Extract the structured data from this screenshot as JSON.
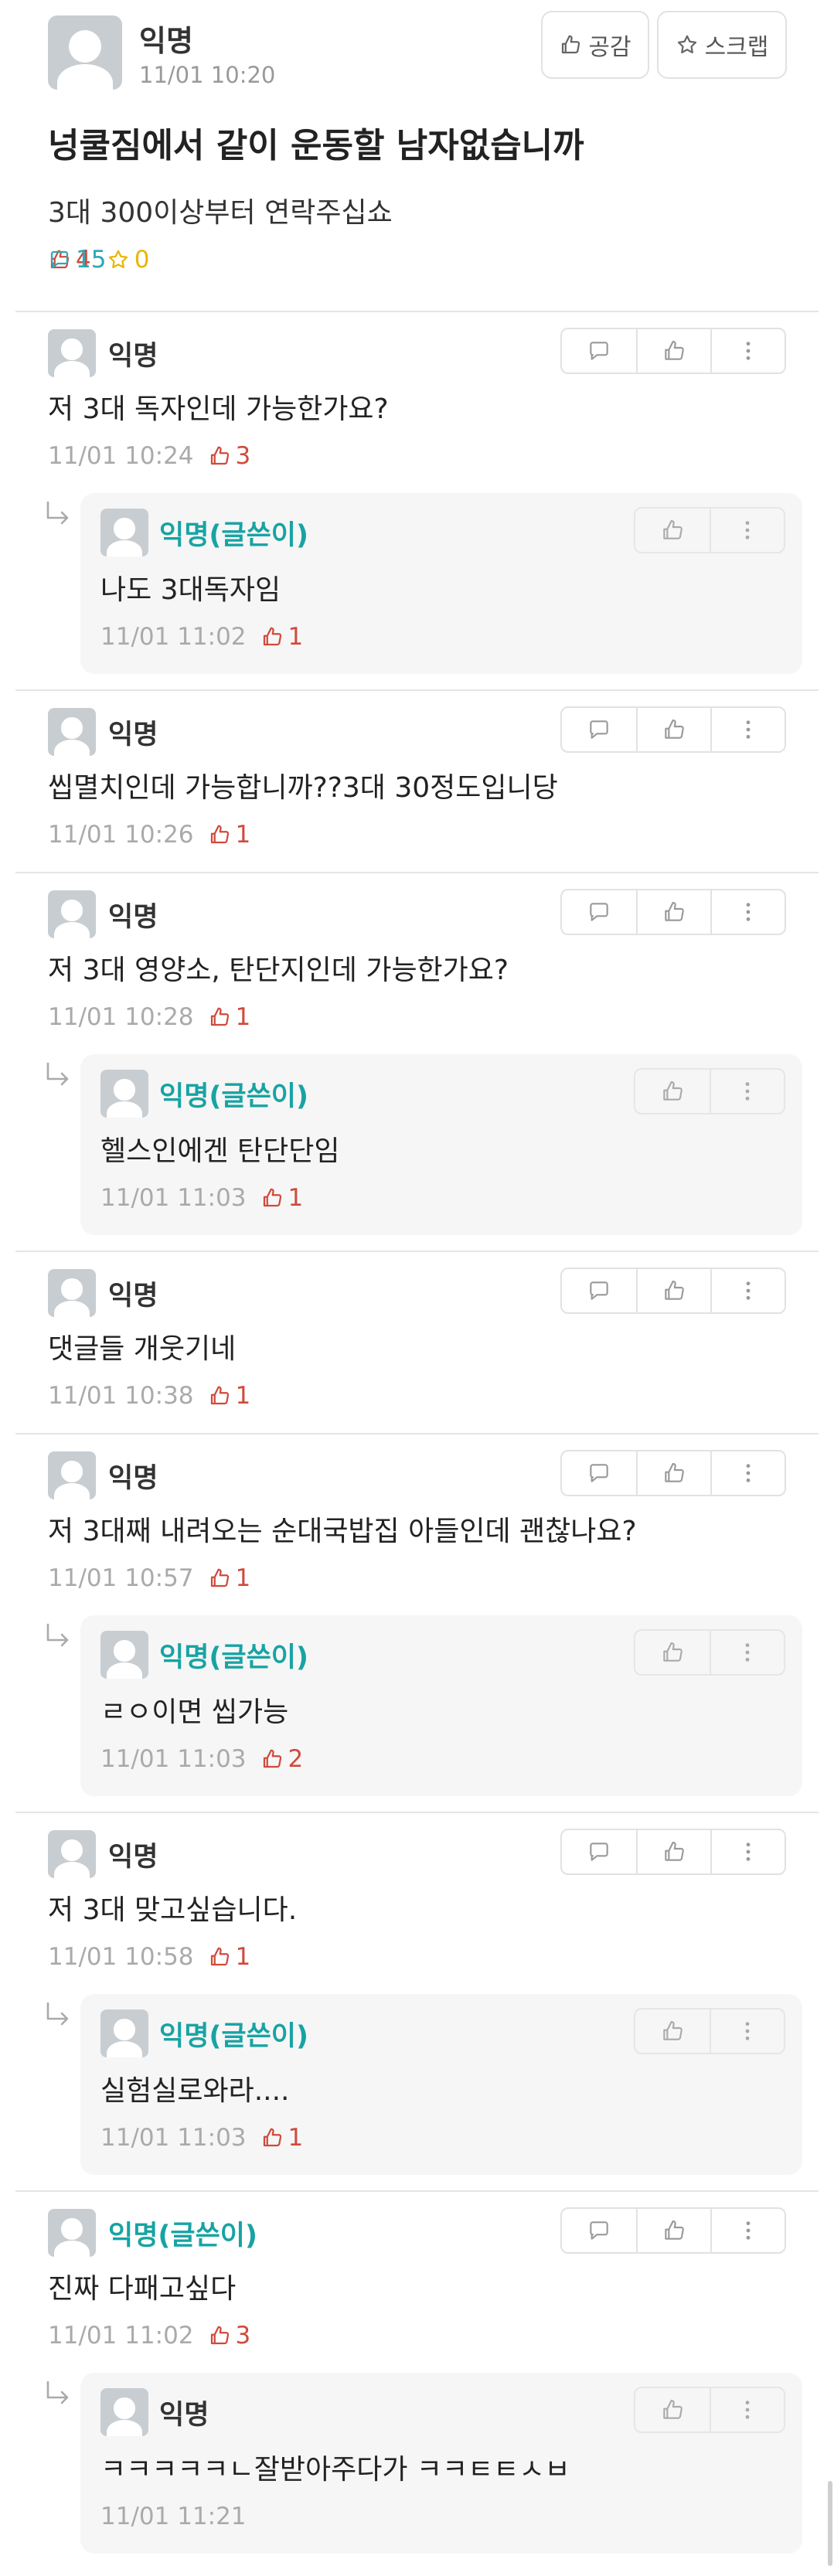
{
  "post": {
    "author": "익명",
    "time": "11/01 10:20",
    "title": "넝쿨짐에서 같이 운동할 남자없습니까",
    "body": "3대 300이상부터 연락주십쇼",
    "like_count": "4",
    "comment_count": "15",
    "scrap_count": "0",
    "like_button_label": "공감",
    "scrap_button_label": "스크랩"
  },
  "comments": [
    {
      "author": "익명",
      "text": "저 3대 독자인데 가능한가요?",
      "time": "11/01 10:24",
      "votes": "3"
    },
    {
      "author": "익명(글쓴이)",
      "text": "나도 3대독자임",
      "time": "11/01 11:02",
      "votes": "1"
    },
    {
      "author": "익명",
      "text": "씹멸치인데 가능합니까??3대 30정도입니당",
      "time": "11/01 10:26",
      "votes": "1"
    },
    {
      "author": "익명",
      "text": "저 3대 영양소, 탄단지인데 가능한가요?",
      "time": "11/01 10:28",
      "votes": "1"
    },
    {
      "author": "익명(글쓴이)",
      "text": "헬스인에겐 탄단단임",
      "time": "11/01 11:03",
      "votes": "1"
    },
    {
      "author": "익명",
      "text": "댓글들 개웃기네",
      "time": "11/01 10:38",
      "votes": "1"
    },
    {
      "author": "익명",
      "text": "저 3대째 내려오는 순대국밥집 아들인데 괜찮나요?",
      "time": "11/01 10:57",
      "votes": "1"
    },
    {
      "author": "익명(글쓴이)",
      "text": "ㄹㅇ이면 씹가능",
      "time": "11/01 11:03",
      "votes": "2"
    },
    {
      "author": "익명",
      "text": "저 3대 맞고싶습니다.",
      "time": "11/01 10:58",
      "votes": "1"
    },
    {
      "author": "익명(글쓴이)",
      "text": "실험실로와라....",
      "time": "11/01 11:03",
      "votes": "1"
    },
    {
      "author": "익명(글쓴이)",
      "text": "진짜 다패고싶다",
      "time": "11/01 11:02",
      "votes": "3"
    },
    {
      "author": "익명",
      "text": "ㅋㅋㅋㅋㅋㄴ잘받아주다가 ㅋㅋㅌㅌㅅㅂ",
      "time": "11/01 11:21",
      "votes": ""
    }
  ],
  "colors": {
    "like_red": "#d04a3c",
    "comment_teal": "#2aa8b6",
    "scrap_yellow": "#e9b500",
    "op_name_teal": "#18a3a3"
  },
  "icons": {
    "like": "thumbs-up-icon",
    "comment": "speech-bubble-icon",
    "scrap": "star-icon",
    "more": "more-vertical-icon",
    "reply": "reply-arrow-icon"
  }
}
